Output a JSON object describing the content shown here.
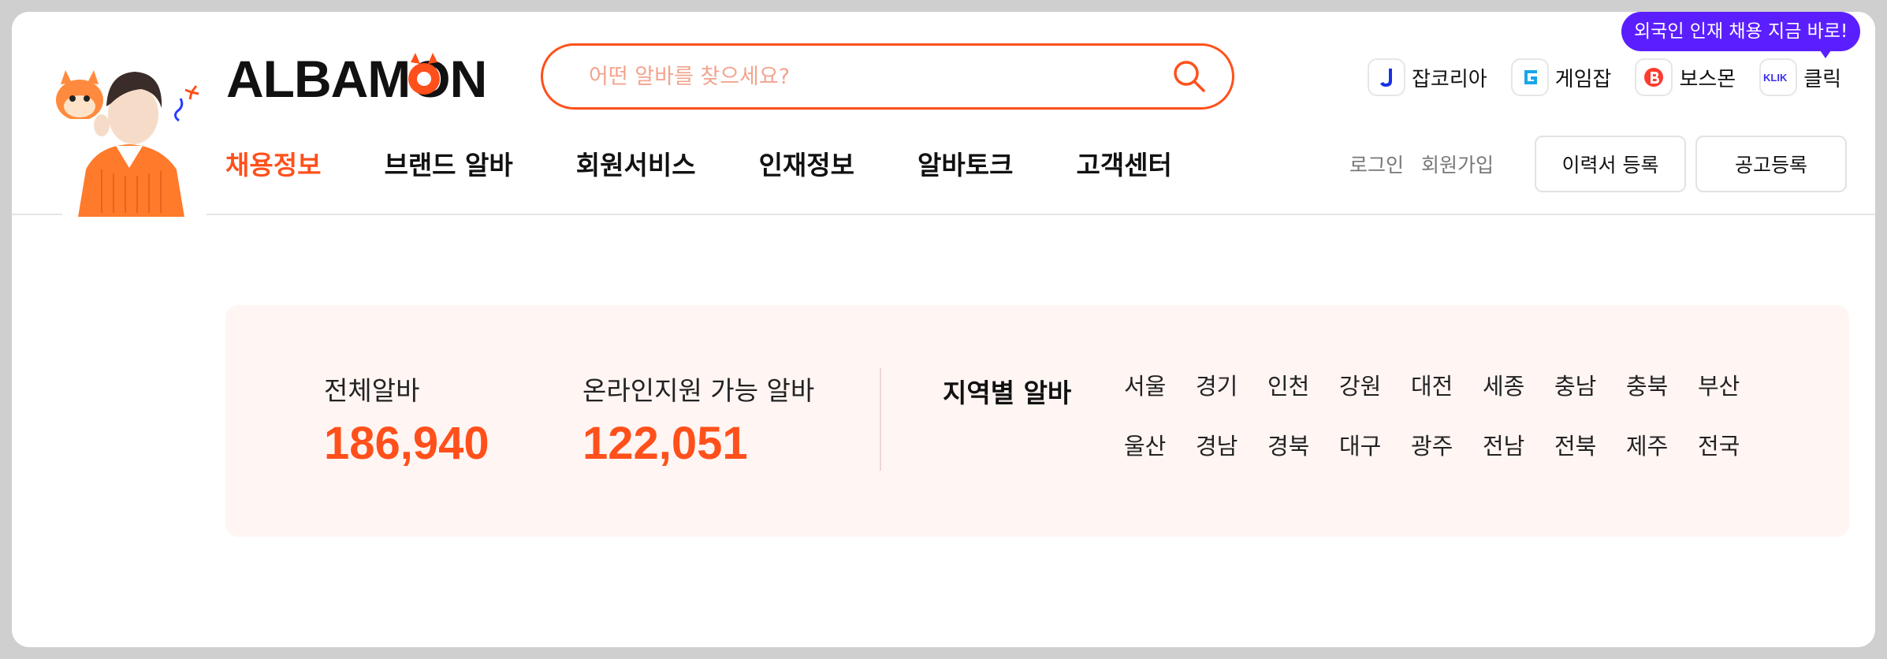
{
  "header": {
    "logo_text": "ALBAMON",
    "search": {
      "placeholder": "어떤 알바를 찾으세요?",
      "value": ""
    },
    "promo_bubble": "외국인 인재 채용 지금 바로!",
    "family_sites": [
      {
        "label": "잡코리아",
        "icon": "jobkorea-icon",
        "color": "#1a31e6"
      },
      {
        "label": "게임잡",
        "icon": "gamejob-icon",
        "color": "#19a6e8"
      },
      {
        "label": "보스몬",
        "icon": "bossmon-icon",
        "color": "#ff3b2f"
      },
      {
        "label": "클릭",
        "icon": "klik-icon",
        "color": "#3d2fe8"
      }
    ],
    "nav": [
      {
        "label": "채용정보",
        "active": true
      },
      {
        "label": "브랜드 알바",
        "active": false
      },
      {
        "label": "회원서비스",
        "active": false
      },
      {
        "label": "인재정보",
        "active": false
      },
      {
        "label": "알바토크",
        "active": false
      },
      {
        "label": "고객센터",
        "active": false
      }
    ],
    "util": {
      "login": "로그인",
      "signup": "회원가입",
      "resume_button": "이력서 등록",
      "post_button": "공고등록"
    }
  },
  "stats": {
    "total": {
      "label": "전체알바",
      "value": "186,940"
    },
    "online": {
      "label": "온라인지원 가능 알바",
      "value": "122,051"
    },
    "region_title": "지역별 알바",
    "regions": [
      "서울",
      "경기",
      "인천",
      "강원",
      "대전",
      "세종",
      "충남",
      "충북",
      "부산",
      "울산",
      "경남",
      "경북",
      "대구",
      "광주",
      "전남",
      "전북",
      "제주",
      "전국"
    ]
  },
  "colors": {
    "brand": "#ff501b",
    "promo": "#5b1fff",
    "panel_bg": "#fff5f3"
  }
}
